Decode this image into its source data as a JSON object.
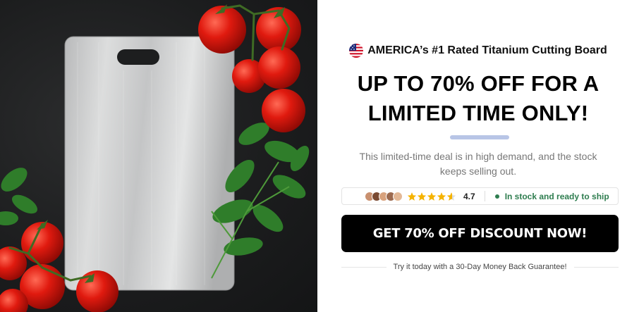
{
  "hero": {
    "image_icon": "titanium-cutting-board-photo"
  },
  "offer": {
    "eyebrow_icon": "us-flag-icon",
    "eyebrow": "AMERICA’s #1 Rated Titanium Cutting Board",
    "headline": "UP TO 70% OFF FOR A LIMITED TIME ONLY!",
    "subtext": "This limited-time deal is in high demand, and the stock keeps selling out.",
    "rating": "4.7",
    "rating_fraction": 0.94,
    "stars_total": 5,
    "stock_status": "In stock and ready to ship",
    "cta_label": "GET 70% OFF DISCOUNT NOW!",
    "guarantee": "Try it today with a 30-Day Money Back Guarantee!"
  },
  "colors": {
    "accent_bar": "#b8c5e6",
    "stock_green": "#2e7d4f",
    "star_gold": "#f5b300",
    "cta_bg": "#000000"
  }
}
